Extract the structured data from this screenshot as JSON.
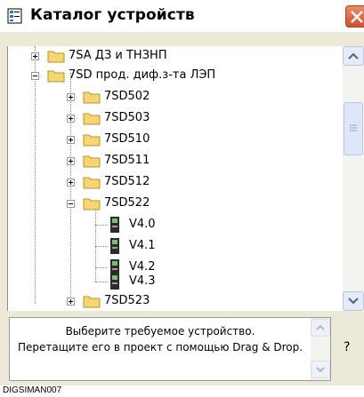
{
  "window": {
    "title": "Каталог устройств"
  },
  "tree": {
    "items": [
      {
        "label": "7SA ДЗ и ТНЗНП",
        "kind": "folder",
        "state": "collapsed",
        "level": 1
      },
      {
        "label": "7SD прод. диф.з-та ЛЭП",
        "kind": "folder",
        "state": "expanded",
        "level": 1
      },
      {
        "label": "7SD502",
        "kind": "folder",
        "state": "collapsed",
        "level": 2
      },
      {
        "label": "7SD503",
        "kind": "folder",
        "state": "collapsed",
        "level": 2
      },
      {
        "label": "7SD510",
        "kind": "folder",
        "state": "collapsed",
        "level": 2
      },
      {
        "label": "7SD511",
        "kind": "folder",
        "state": "collapsed",
        "level": 2
      },
      {
        "label": "7SD512",
        "kind": "folder",
        "state": "collapsed",
        "level": 2
      },
      {
        "label": "7SD522",
        "kind": "folder",
        "state": "expanded",
        "level": 2
      },
      {
        "label": "V4.0",
        "kind": "device",
        "level": 3
      },
      {
        "label": "V4.1",
        "kind": "device",
        "level": 3
      },
      {
        "label": "V4.2",
        "kind": "device",
        "level": 3
      },
      {
        "label": "V4.3",
        "kind": "device",
        "level": 3
      },
      {
        "label": "7SD523",
        "kind": "folder",
        "state": "collapsed",
        "level": 2
      }
    ]
  },
  "info": {
    "line1": "Выберите требуемое устройство.",
    "line2": "Перетащите его в проект с помощью Drag & Drop.",
    "help_label": "?"
  },
  "caption": "DIGSIMAN007",
  "colors": {
    "folder": "#f5d672",
    "close": "#d2502f",
    "scroll": "#e6ebf7"
  }
}
